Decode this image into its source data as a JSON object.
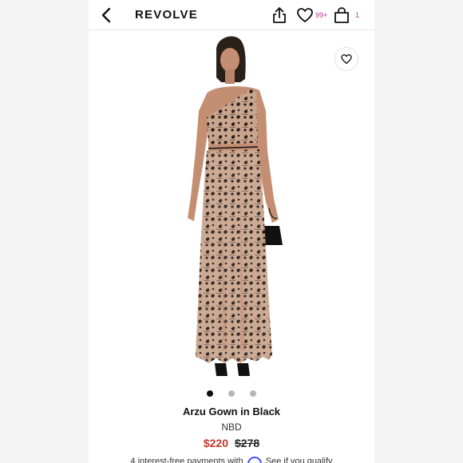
{
  "header": {
    "logo": "REVOLVE",
    "wishlist_count": "99+",
    "bag_count": "1",
    "icons": [
      "back-arrow-icon",
      "share-icon",
      "heart-icon",
      "shopping-bag-icon"
    ]
  },
  "gallery": {
    "image": "model-wearing-black-lace-gown",
    "favorite_icon": "heart-icon",
    "slide_count": 3,
    "active_slide": 1
  },
  "product": {
    "name": "Arzu Gown in Black",
    "brand": "NBD",
    "sale_price": "$220",
    "original_price": "$278"
  },
  "payments": {
    "text": "4 interest-free payments with",
    "link_text": "See if you qualify",
    "logo": "affirm-logo"
  },
  "colors": {
    "sale_price": "#c0392b",
    "badge": "#b43c8c",
    "affirm": "#4a4af4"
  }
}
